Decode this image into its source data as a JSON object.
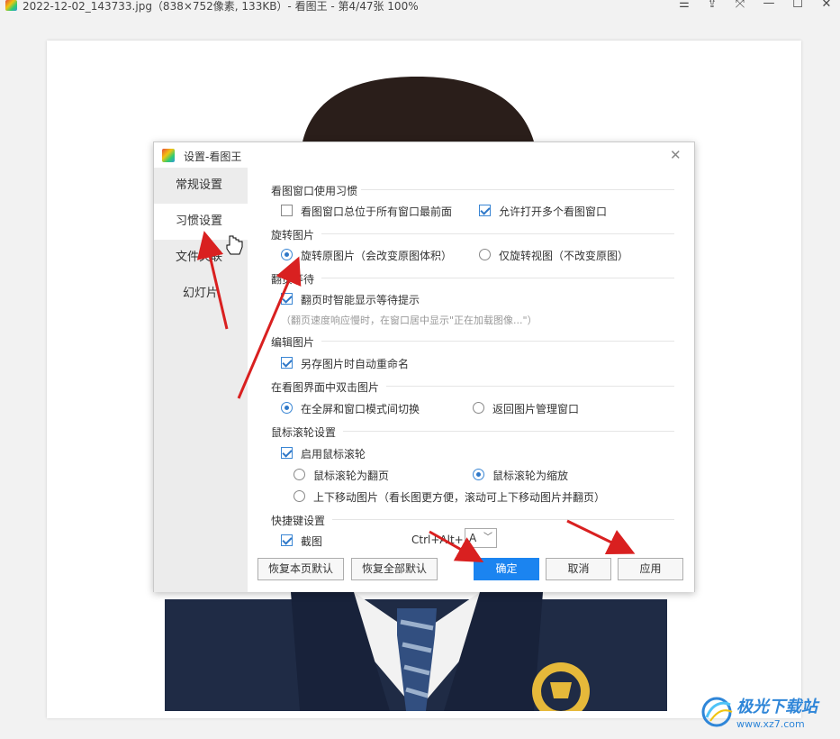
{
  "window": {
    "title": "2022-12-02_143733.jpg（838×752像素, 133KB）- 看图王 - 第4/47张 100%",
    "controls": [
      "☰",
      "⇪",
      "⤧",
      "☐",
      "✕"
    ]
  },
  "dialog": {
    "title": "设置-看图王",
    "sidebar": [
      {
        "label": "常规设置",
        "active": false
      },
      {
        "label": "习惯设置",
        "active": true
      },
      {
        "label": "文件关联",
        "active": false
      },
      {
        "label": "幻灯片",
        "active": false
      }
    ],
    "sections": {
      "window_habits": {
        "title": "看图窗口使用习惯",
        "always_on_top": {
          "label": "看图窗口总位于所有窗口最前面",
          "checked": false
        },
        "multi_window": {
          "label": "允许打开多个看图窗口",
          "checked": true
        }
      },
      "rotate": {
        "title": "旋转图片",
        "rotate_original": {
          "label": "旋转原图片（会改变原图体积）",
          "selected": true
        },
        "rotate_view": {
          "label": "仅旋转视图（不改变原图）",
          "selected": false
        }
      },
      "page_wait": {
        "title": "翻页等待",
        "smart_hint": {
          "label": "翻页时智能显示等待提示",
          "checked": true
        },
        "hint_text": "（翻页速度响应慢时，在窗口居中显示\"正在加载图像...\"）"
      },
      "edit": {
        "title": "编辑图片",
        "auto_rename": {
          "label": "另存图片时自动重命名",
          "checked": true
        }
      },
      "double_click": {
        "title": "在看图界面中双击图片",
        "toggle_fullscreen": {
          "label": "在全屏和窗口模式间切换",
          "selected": true
        },
        "back_to_manager": {
          "label": "返回图片管理窗口",
          "selected": false
        }
      },
      "wheel": {
        "title": "鼠标滚轮设置",
        "enable_wheel": {
          "label": "启用鼠标滚轮",
          "checked": true
        },
        "wheel_page": {
          "label": "鼠标滚轮为翻页",
          "selected": false
        },
        "wheel_zoom": {
          "label": "鼠标滚轮为缩放",
          "selected": true
        },
        "wheel_move": {
          "label": "上下移动图片（看长图更方便，滚动可上下移动图片并翻页）",
          "selected": false
        }
      },
      "shortcut": {
        "title": "快捷键设置",
        "screenshot": {
          "label": "截图",
          "checked": true
        },
        "combo_label": "Ctrl+Alt+",
        "key_value": "A"
      }
    },
    "buttons": {
      "restore_page": "恢复本页默认",
      "restore_all": "恢复全部默认",
      "ok": "确定",
      "cancel": "取消",
      "apply": "应用"
    }
  },
  "watermark": {
    "brand": "极光下载站",
    "url": "www.xz7.com"
  },
  "colors": {
    "accent": "#1b84f0",
    "arrow": "#d92020",
    "sidebar_bg": "#ececec"
  }
}
